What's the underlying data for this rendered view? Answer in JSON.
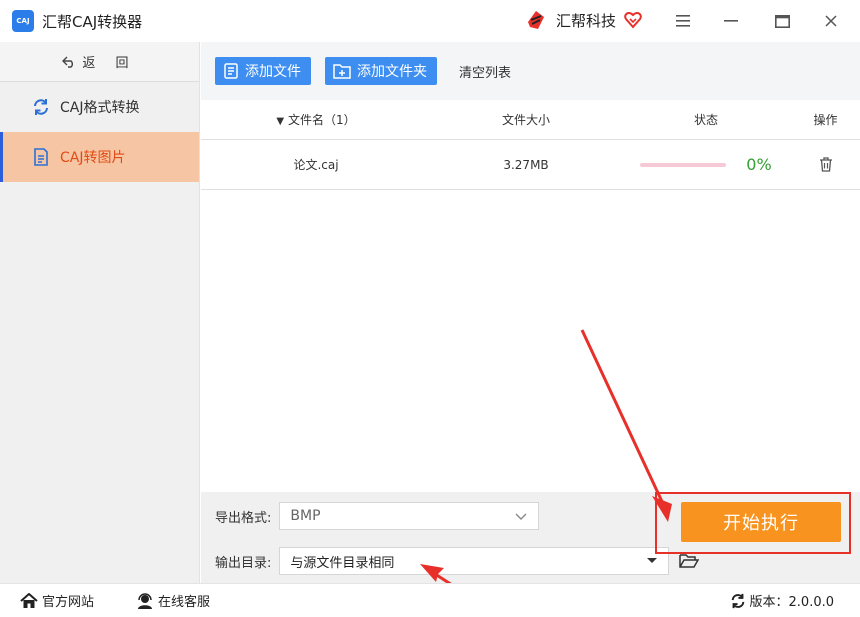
{
  "app": {
    "logo_text": "CAJ",
    "title": "汇帮CAJ转换器",
    "brand": "汇帮科技"
  },
  "sidebar": {
    "back_label": "返 回",
    "items": [
      {
        "label": "CAJ格式转换",
        "icon": "refresh-icon",
        "active": false
      },
      {
        "label": "CAJ转图片",
        "icon": "document-icon",
        "active": true
      }
    ]
  },
  "toolbar": {
    "add_file": "添加文件",
    "add_folder": "添加文件夹",
    "clear_list": "清空列表"
  },
  "table": {
    "headers": {
      "name": "文件名（1）",
      "size": "文件大小",
      "status": "状态",
      "op": "操作"
    },
    "rows": [
      {
        "name": "论文.caj",
        "size": "3.27MB",
        "progress": 0,
        "progress_label": "0%"
      }
    ]
  },
  "settings": {
    "format_label": "导出格式:",
    "format_value": "BMP",
    "dir_label": "输出目录:",
    "dir_value": "与源文件目录相同",
    "start_label": "开始执行"
  },
  "statusbar": {
    "website": "官方网站",
    "support": "在线客服",
    "version": "版本：2.0.0.0"
  },
  "colors": {
    "accent_blue": "#3d8ef0",
    "active_nav_bg": "#f6c5a3",
    "active_nav_text": "#e24b14",
    "start_button": "#f7931e",
    "annotation_red": "#e8302a",
    "progress_text": "#33a033"
  }
}
